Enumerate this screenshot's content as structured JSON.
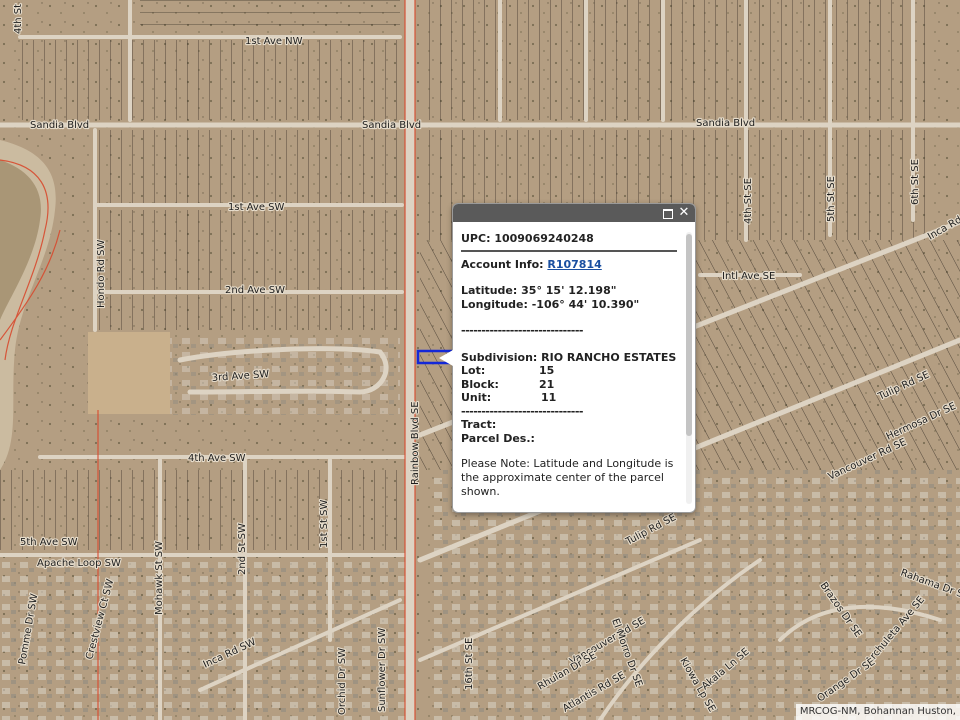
{
  "map": {
    "streets": {
      "first_ave_nw": "1st Ave NW",
      "sandia_blvd_w": "Sandia Blvd",
      "sandia_blvd_e": "Sandia Blvd",
      "first_ave_sw": "1st Ave SW",
      "second_ave_sw": "2nd Ave SW",
      "third_ave_sw": "3rd Ave SW",
      "fourth_ave_sw": "4th Ave SW",
      "fifth_ave_sw": "5th Ave SW",
      "apache_loop_sw": "Apache Loop SW",
      "intl_ave_se": "Intl Ave SE",
      "inca_rd_se": "Inca Rd SE",
      "inca_rd_sw": "Inca Rd SW",
      "tulip_rd_se_n": "Tulip Rd SE",
      "tulip_rd_se_s": "Tulip Rd SE",
      "rainbow_blvd_se": "Rainbow Blvd SE",
      "hondo_rd_sw": "Hondo Rd SW",
      "fourth_st_se": "4th St SE",
      "fifth_st_se": "5th St SE",
      "sixth_st_se": "6th St SE",
      "fourth_st_top": "4th St",
      "first_st_sw": "1st St SW",
      "second_st_sw": "2nd St SW",
      "mohawk_st_sw": "Mohawk St SW",
      "vancouver_rd_se_e": "Vancouver Rd SE",
      "vancouver_rd_se_w": "Vancouver Rd SE",
      "hermosa_dr_se": "Hermosa Dr SE",
      "brazos_dr_se": "Brazos Dr SE",
      "archuleta_ave_se": "Archuleta Ave SE",
      "rahama_dr_se": "Rahama Dr SE",
      "orange_dr_se": "Orange Dr SE",
      "kiowa_loop_se": "Kiowa Lp SE",
      "akala_ln_se": "Akala Ln SE",
      "el_morro_dr_se": "El Morro Dr SE",
      "rhulan_dr_se": "Rhulan Dr SE",
      "atlantis_rd_se": "Atlantis Rd SE",
      "sixteenth_st_se": "16th St SE",
      "sunflower_dr_sw": "Sunflower Dr SW",
      "orchid_dr_sw": "Orchid Dr SW",
      "pomme_dr_sw": "Pomme Dr SW",
      "crestview_ct_sw": "Crestview Ct SW"
    },
    "colors": {
      "ground": "#b49e82",
      "road": "#ddd3c3",
      "lot_line": "#3a3128",
      "jurisdiction_line": "#d84a2e",
      "selected_parcel": "#1428d8"
    }
  },
  "popup": {
    "upc_label": "UPC:",
    "upc_value": "1009069240248",
    "account_label": "Account Info:",
    "account_link": "R107814",
    "latitude_label": "Latitude:",
    "latitude_value": "35° 15' 12.198\"",
    "longitude_label": "Longitude:",
    "longitude_value": "-106° 44' 10.390\"",
    "dash_line": "------------------------------",
    "subdivision_label": "Subdivision:",
    "subdivision_value": "RIO RANCHO ESTATES",
    "lot_label": "Lot:",
    "lot_value": "15",
    "block_label": "Block:",
    "block_value": "21",
    "unit_label": "Unit:",
    "unit_value": "11",
    "tract_label": "Tract:",
    "parcel_des_label": "Parcel Des.:",
    "note": "Please Note: Latitude and Longitude is the approximate center of the parcel shown.",
    "maximize_icon": "maximize-icon",
    "close_icon": "close-icon",
    "close_glyph": "✕"
  },
  "attribution": "MRCOG-NM, Bohannan Huston,"
}
